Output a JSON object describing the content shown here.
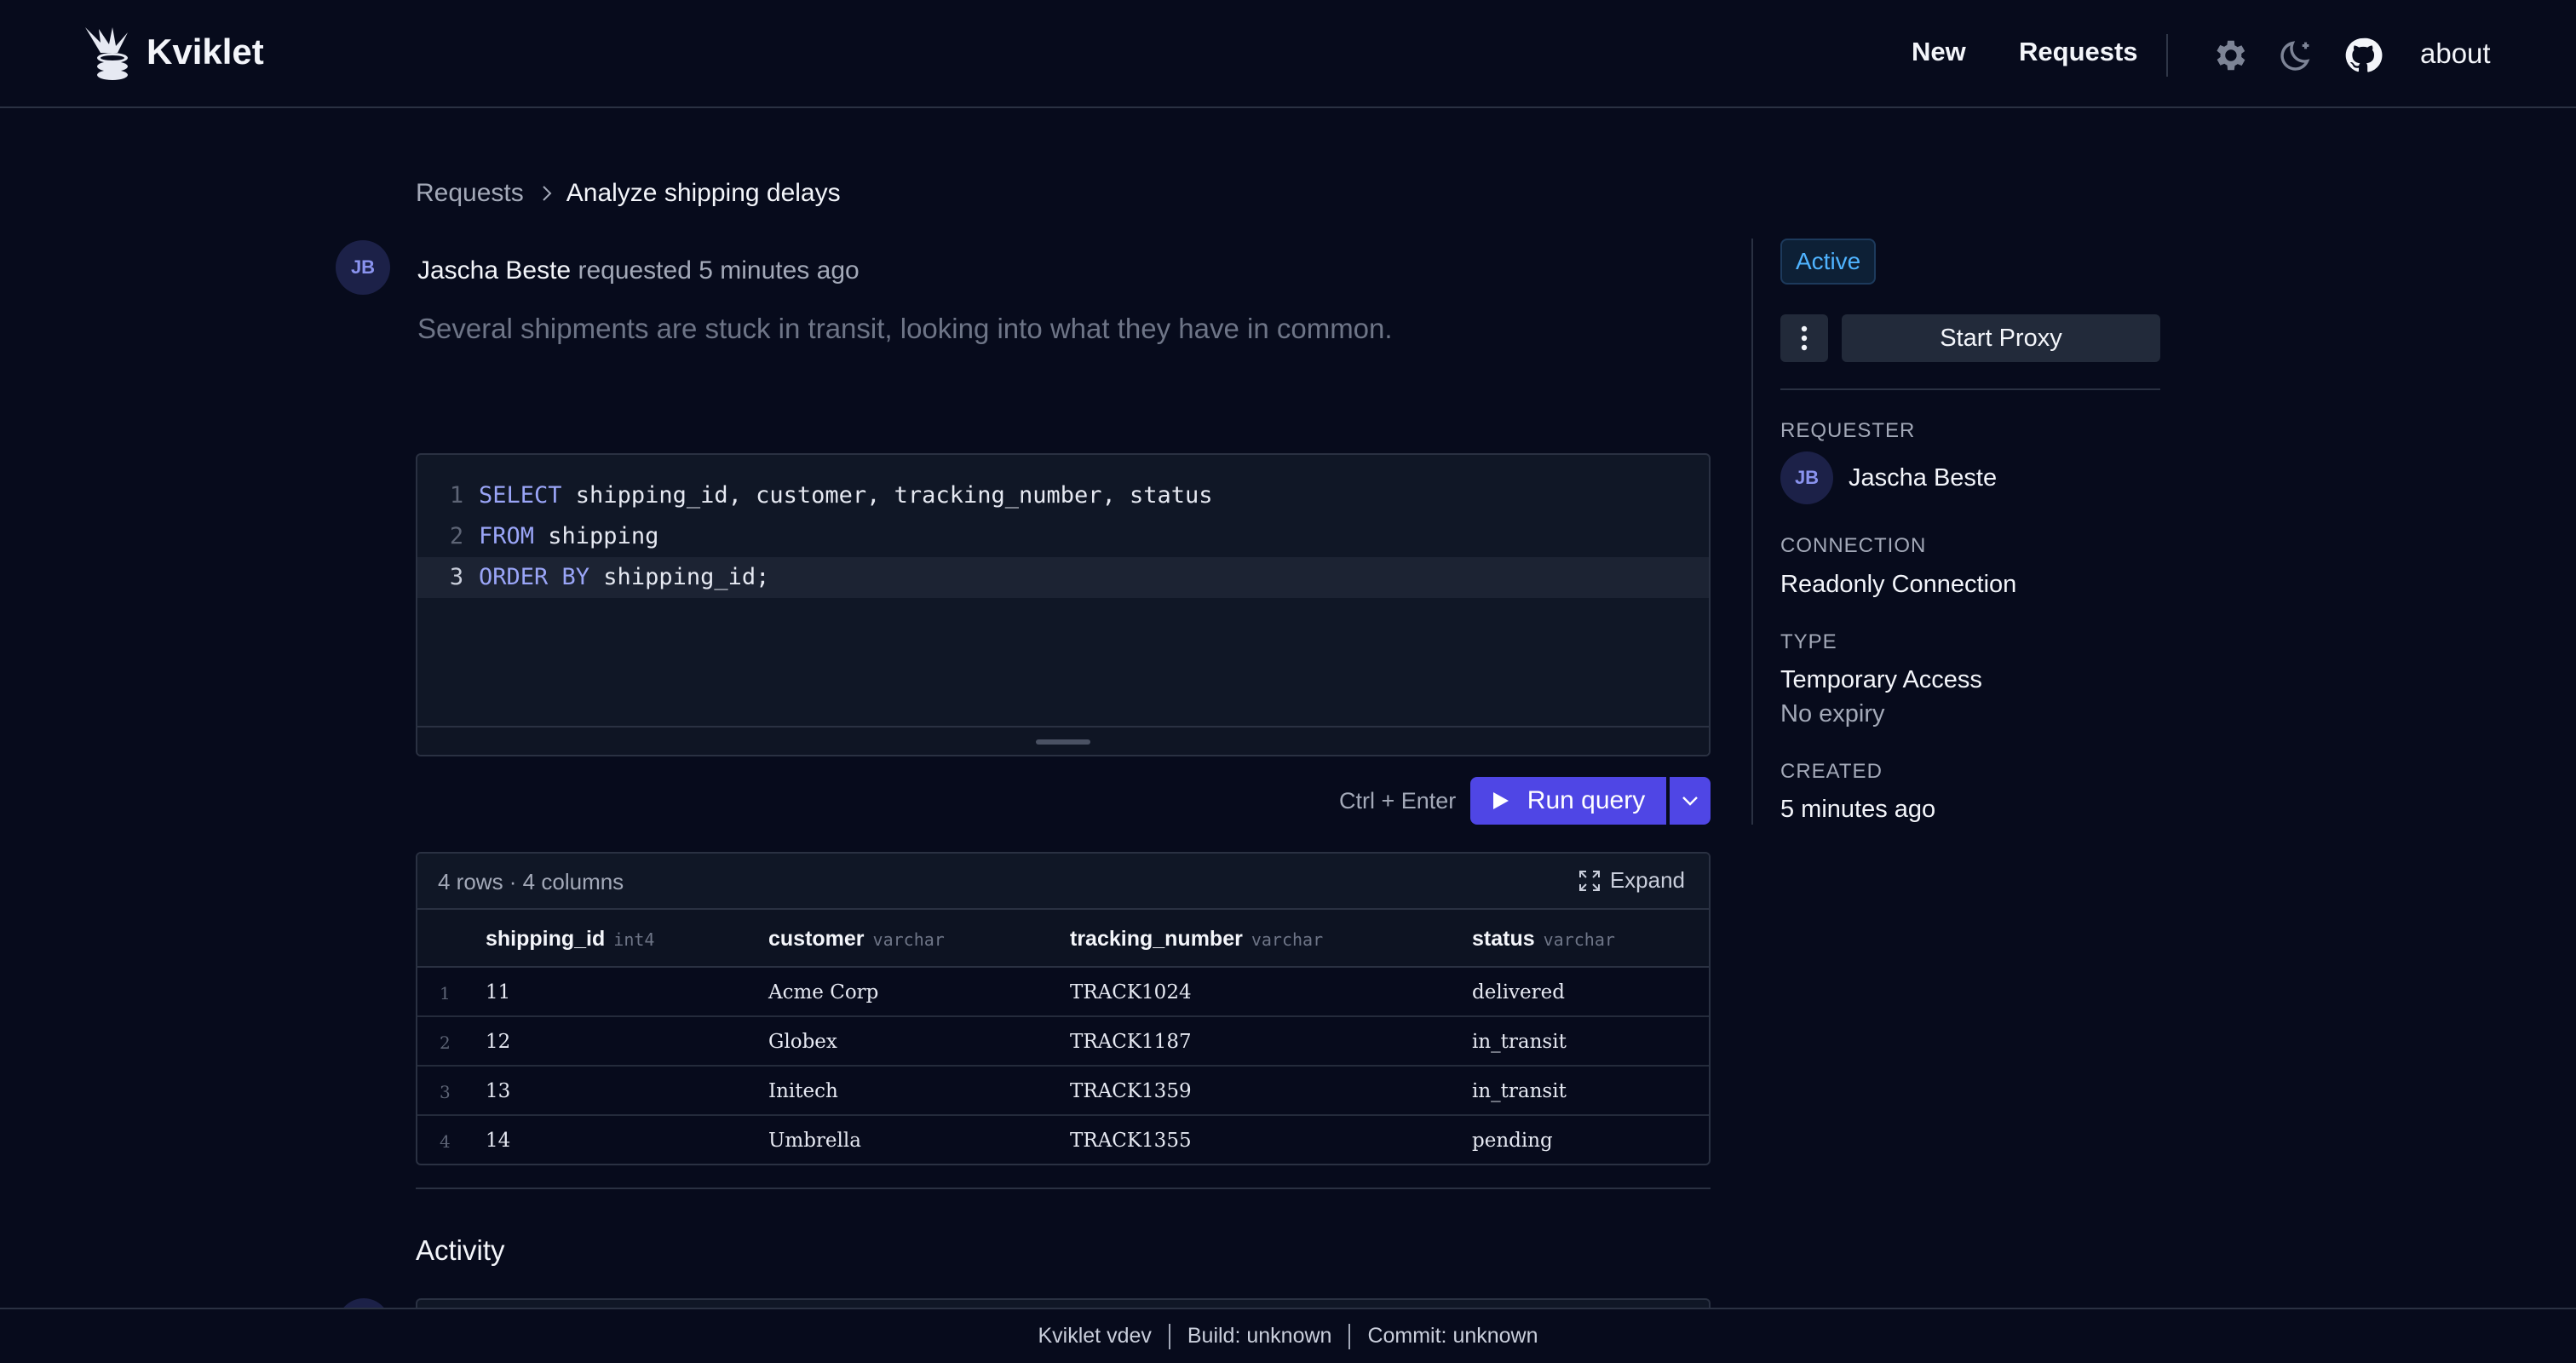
{
  "app": {
    "name": "Kviklet",
    "nav": {
      "new": "New",
      "requests": "Requests",
      "about": "about"
    },
    "icons": [
      "settings-icon",
      "theme-toggle-icon",
      "github-icon"
    ]
  },
  "breadcrumb": {
    "parent": "Requests",
    "current": "Analyze shipping delays"
  },
  "request": {
    "avatar_initials": "JB",
    "requester": "Jascha Beste",
    "action": "requested",
    "time": "5 minutes ago",
    "description": "Several shipments are stuck in transit, looking into what they have in common."
  },
  "editor": {
    "lines": [
      {
        "num": "1",
        "kw": "SELECT",
        "rest": " shipping_id, customer, tracking_number, status"
      },
      {
        "num": "2",
        "kw": "FROM",
        "rest": " shipping"
      },
      {
        "num": "3",
        "kw": "ORDER BY",
        "rest": " shipping_id;"
      }
    ]
  },
  "run": {
    "shortcut": "Ctrl + Enter",
    "label": "Run query"
  },
  "results": {
    "meta": "4 rows · 4 columns",
    "expand": "Expand",
    "columns": [
      {
        "name": "shipping_id",
        "type": "int4"
      },
      {
        "name": "customer",
        "type": "varchar"
      },
      {
        "name": "tracking_number",
        "type": "varchar"
      },
      {
        "name": "status",
        "type": "varchar"
      }
    ],
    "rows": [
      {
        "n": "1",
        "cells": [
          "11",
          "Acme Corp",
          "TRACK1024",
          "delivered"
        ]
      },
      {
        "n": "2",
        "cells": [
          "12",
          "Globex",
          "TRACK1187",
          "in_transit"
        ]
      },
      {
        "n": "3",
        "cells": [
          "13",
          "Initech",
          "TRACK1359",
          "in_transit"
        ]
      },
      {
        "n": "4",
        "cells": [
          "14",
          "Umbrella",
          "TRACK1355",
          "pending"
        ]
      }
    ]
  },
  "activity": {
    "title": "Activity"
  },
  "sidebar": {
    "status": "Active",
    "proxy_button": "Start Proxy",
    "requester_label": "REQUESTER",
    "requester_initials": "JB",
    "requester_name": "Jascha Beste",
    "connection_label": "CONNECTION",
    "connection_value": "Readonly Connection",
    "type_label": "TYPE",
    "type_value": "Temporary Access",
    "type_sub": "No expiry",
    "created_label": "CREATED",
    "created_value": "5 minutes ago"
  },
  "footer": {
    "version": "Kviklet vdev",
    "build": "Build: unknown",
    "commit": "Commit: unknown"
  },
  "colors": {
    "accent": "#4f46e5",
    "active_badge": "#4fb3ff",
    "background": "#070b1c"
  }
}
